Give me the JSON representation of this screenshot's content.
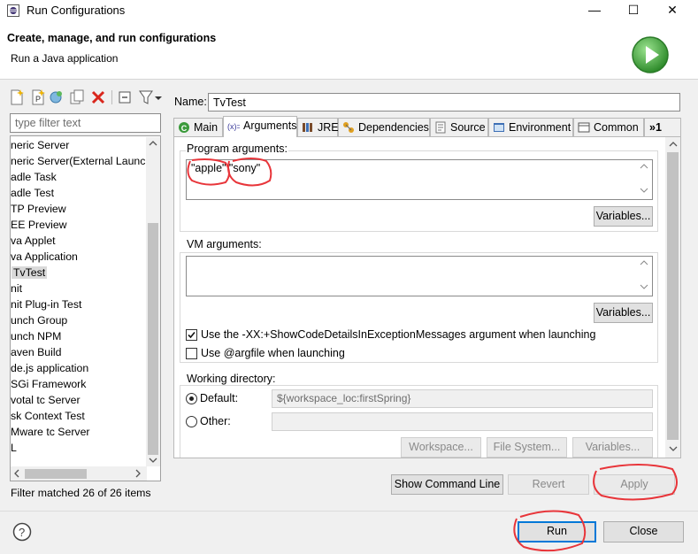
{
  "window": {
    "title": "Run Configurations",
    "minimize_glyph": "—",
    "maximize_glyph": "☐",
    "close_glyph": "✕"
  },
  "header": {
    "heading": "Create, manage, and run configurations",
    "subtitle": "Run a Java application"
  },
  "left": {
    "filter_placeholder": "type filter text",
    "tree_items": [
      "neric Server",
      "neric Server(External Launch",
      "adle Task",
      "adle Test",
      "TP Preview",
      "EE Preview",
      "va Applet",
      "va Application",
      "TvTest",
      "nit",
      "nit Plug-in Test",
      "unch Group",
      "unch NPM",
      "aven Build",
      "de.js application",
      "SGi Framework",
      "votal tc Server",
      "sk Context Test",
      "Mware tc Server",
      "L"
    ],
    "selected_item": "TvTest",
    "filter_status": "Filter matched 26 of 26 items"
  },
  "config": {
    "name_label": "Name:",
    "name_value": "TvTest",
    "tabs": [
      "Main",
      "Arguments",
      "JRE",
      "Dependencies",
      "Source",
      "Environment",
      "Common",
      "»1"
    ],
    "active_tab": "Arguments"
  },
  "arguments": {
    "program_args_label": "Program arguments:",
    "program_args_value": "\"apple\" \"sony\"",
    "variables_label": "Variables...",
    "vm_args_label": "VM arguments:",
    "vm_args_value": "",
    "show_code_details_label": "Use the -XX:+ShowCodeDetailsInExceptionMessages argument when launching",
    "show_code_details_checked": true,
    "argfile_label": "Use @argfile when launching",
    "argfile_checked": false,
    "working_dir_label": "Working directory:",
    "default_label": "Default:",
    "default_value": "${workspace_loc:firstSpring}",
    "other_label": "Other:",
    "workspace_button": "Workspace...",
    "filesystem_button": "File System...",
    "wd_variables_button": "Variables..."
  },
  "buttons": {
    "show_command_line": "Show Command Line",
    "revert": "Revert",
    "apply": "Apply",
    "run": "Run",
    "close": "Close"
  },
  "icons": {
    "help": "help-icon",
    "run_large": "run-icon"
  },
  "colors": {
    "accent": "#0078d7",
    "annotation": "#e8353a",
    "run_green": "#3fa83a"
  }
}
